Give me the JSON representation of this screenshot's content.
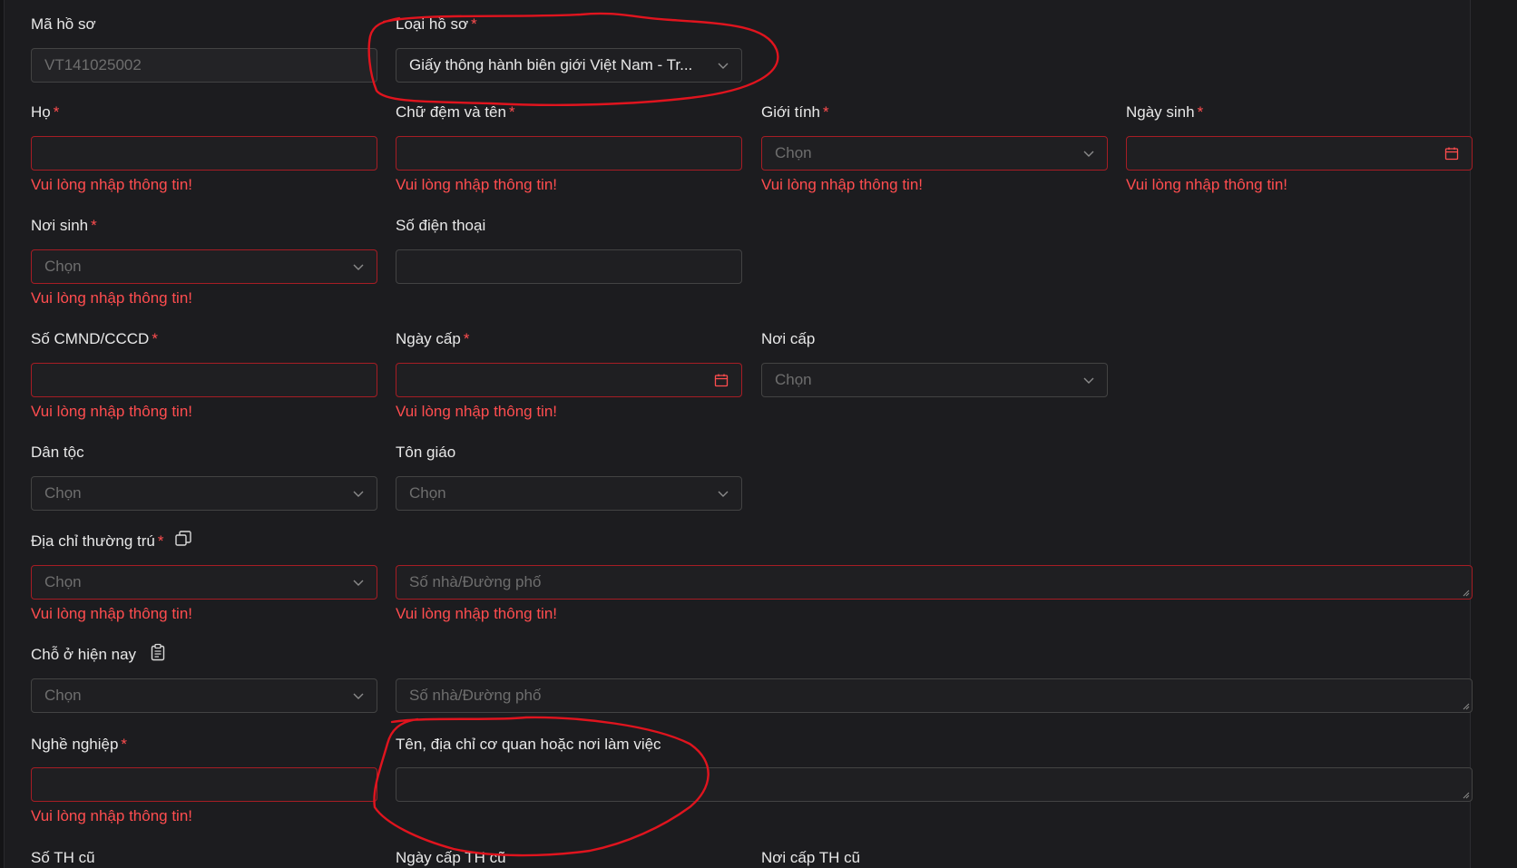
{
  "form": {
    "ma_ho_so": {
      "label": "Mã hồ sơ",
      "value": "VT141025002"
    },
    "loai_ho_so": {
      "label": "Loại hồ sơ",
      "required": "*",
      "value": "Giấy thông hành biên giới Việt Nam - Tr..."
    },
    "ho": {
      "label": "Họ",
      "required": "*",
      "error": "Vui lòng nhập thông tin!"
    },
    "chu_dem_ten": {
      "label": "Chữ đệm và tên",
      "required": "*",
      "error": "Vui lòng nhập thông tin!"
    },
    "gioi_tinh": {
      "label": "Giới tính",
      "required": "*",
      "placeholder": "Chọn",
      "error": "Vui lòng nhập thông tin!"
    },
    "ngay_sinh": {
      "label": "Ngày sinh",
      "required": "*",
      "error": "Vui lòng nhập thông tin!"
    },
    "noi_sinh": {
      "label": "Nơi sinh",
      "required": "*",
      "placeholder": "Chọn",
      "error": "Vui lòng nhập thông tin!"
    },
    "so_dien_thoai": {
      "label": "Số điện thoại"
    },
    "so_cmnd": {
      "label": "Số CMND/CCCD",
      "required": "*",
      "error": "Vui lòng nhập thông tin!"
    },
    "ngay_cap": {
      "label": "Ngày cấp",
      "required": "*",
      "error": "Vui lòng nhập thông tin!"
    },
    "noi_cap": {
      "label": "Nơi cấp",
      "placeholder": "Chọn"
    },
    "dan_toc": {
      "label": "Dân tộc",
      "placeholder": "Chọn"
    },
    "ton_giao": {
      "label": "Tôn giáo",
      "placeholder": "Chọn"
    },
    "dia_chi_thuong_tru": {
      "label": "Địa chỉ thường trú",
      "required": "*",
      "placeholder": "Chọn",
      "street_placeholder": "Số nhà/Đường phố",
      "error": "Vui lòng nhập thông tin!",
      "street_error": "Vui lòng nhập thông tin!"
    },
    "cho_o_hien_nay": {
      "label": "Chỗ ở hiện nay",
      "placeholder": "Chọn",
      "street_placeholder": "Số nhà/Đường phố"
    },
    "nghe_nghiep": {
      "label": "Nghề nghiệp",
      "required": "*",
      "error": "Vui lòng nhập thông tin!"
    },
    "co_quan": {
      "label": "Tên, địa chỉ cơ quan hoặc nơi làm việc"
    },
    "so_th_cu": {
      "label": "Số TH cũ"
    },
    "ngay_cap_th_cu": {
      "label": "Ngày cấp TH cũ"
    },
    "noi_cap_th_cu": {
      "label": "Nơi cấp TH cũ"
    }
  },
  "icons": {
    "chevron": "chevron-down-icon",
    "calendar": "calendar-icon",
    "copy": "copy-icon",
    "paste": "clipboard-icon"
  },
  "colors": {
    "error": "#ff4d4f",
    "annotation": "#e0141e",
    "background": "#1c1c1f"
  }
}
